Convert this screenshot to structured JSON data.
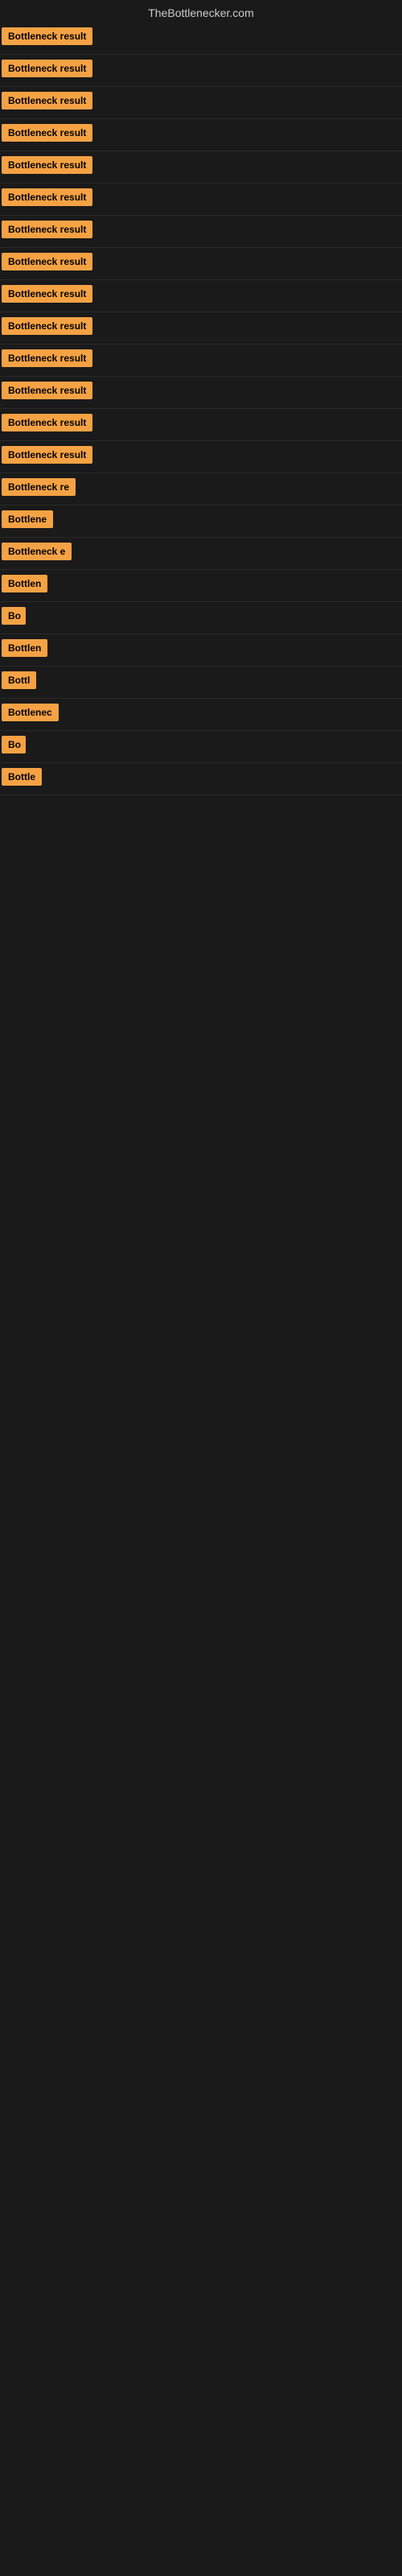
{
  "site": {
    "title": "TheBottlenecker.com"
  },
  "results": [
    {
      "id": 1,
      "label": "Bottleneck result",
      "width": 130
    },
    {
      "id": 2,
      "label": "Bottleneck result",
      "width": 130
    },
    {
      "id": 3,
      "label": "Bottleneck result",
      "width": 130
    },
    {
      "id": 4,
      "label": "Bottleneck result",
      "width": 130
    },
    {
      "id": 5,
      "label": "Bottleneck result",
      "width": 130
    },
    {
      "id": 6,
      "label": "Bottleneck result",
      "width": 130
    },
    {
      "id": 7,
      "label": "Bottleneck result",
      "width": 130
    },
    {
      "id": 8,
      "label": "Bottleneck result",
      "width": 130
    },
    {
      "id": 9,
      "label": "Bottleneck result",
      "width": 130
    },
    {
      "id": 10,
      "label": "Bottleneck result",
      "width": 130
    },
    {
      "id": 11,
      "label": "Bottleneck result",
      "width": 130
    },
    {
      "id": 12,
      "label": "Bottleneck result",
      "width": 130
    },
    {
      "id": 13,
      "label": "Bottleneck result",
      "width": 130
    },
    {
      "id": 14,
      "label": "Bottleneck result",
      "width": 130
    },
    {
      "id": 15,
      "label": "Bottleneck re",
      "width": 100
    },
    {
      "id": 16,
      "label": "Bottlene",
      "width": 80
    },
    {
      "id": 17,
      "label": "Bottleneck e",
      "width": 90
    },
    {
      "id": 18,
      "label": "Bottlen",
      "width": 72
    },
    {
      "id": 19,
      "label": "Bo",
      "width": 30
    },
    {
      "id": 20,
      "label": "Bottlen",
      "width": 72
    },
    {
      "id": 21,
      "label": "Bottl",
      "width": 50
    },
    {
      "id": 22,
      "label": "Bottlenec",
      "width": 85
    },
    {
      "id": 23,
      "label": "Bo",
      "width": 30
    },
    {
      "id": 24,
      "label": "Bottle",
      "width": 60
    }
  ],
  "colors": {
    "badge_bg": "#f4a244",
    "badge_text": "#000000",
    "site_title": "#cccccc",
    "page_bg": "#1a1a1a"
  }
}
